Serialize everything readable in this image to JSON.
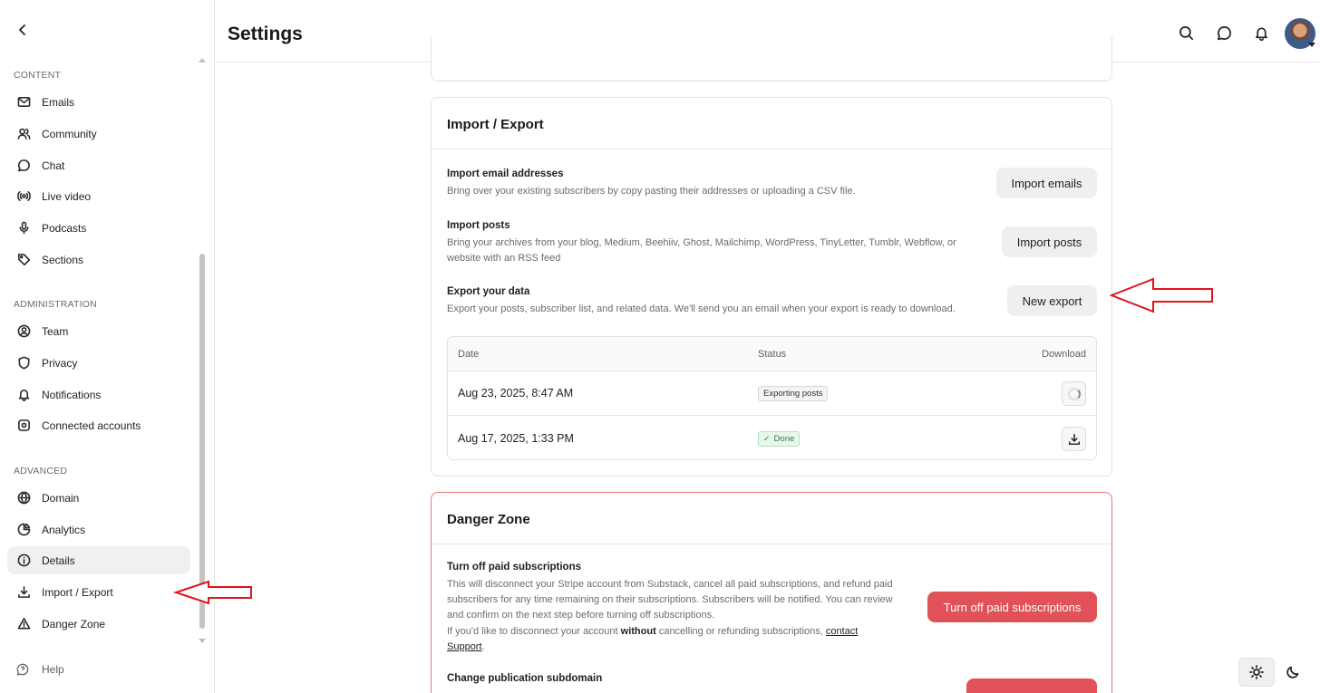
{
  "header": {
    "title": "Settings"
  },
  "sidebar": {
    "sections": [
      {
        "label": "CONTENT"
      },
      {
        "label": "ADMINISTRATION"
      },
      {
        "label": "ADVANCED"
      }
    ],
    "items": [
      {
        "label": "Emails",
        "icon": "mail-icon"
      },
      {
        "label": "Community",
        "icon": "users-icon"
      },
      {
        "label": "Chat",
        "icon": "chat-bubble-icon"
      },
      {
        "label": "Live video",
        "icon": "broadcast-icon"
      },
      {
        "label": "Podcasts",
        "icon": "microphone-icon"
      },
      {
        "label": "Sections",
        "icon": "tag-icon"
      },
      {
        "label": "Team",
        "icon": "user-circle-icon"
      },
      {
        "label": "Privacy",
        "icon": "shield-icon"
      },
      {
        "label": "Notifications",
        "icon": "bell-icon"
      },
      {
        "label": "Connected accounts",
        "icon": "gear-icon"
      },
      {
        "label": "Domain",
        "icon": "globe-icon"
      },
      {
        "label": "Analytics",
        "icon": "pie-chart-icon"
      },
      {
        "label": "Details",
        "icon": "info-icon"
      },
      {
        "label": "Import / Export",
        "icon": "download-icon"
      },
      {
        "label": "Danger Zone",
        "icon": "warning-icon"
      }
    ],
    "active": "Details",
    "help": "Help"
  },
  "import_export": {
    "title": "Import / Export",
    "rows": [
      {
        "title": "Import email addresses",
        "desc": "Bring over your existing subscribers by copy pasting their addresses or uploading a CSV file.",
        "button": "Import emails"
      },
      {
        "title": "Import posts",
        "desc_1": "Bring your archives from your blog, Medium, Beehiiv, Ghost, Mailchimp, WordPress, TinyLetter, Tumblr, Webflow, or",
        "desc_2": "website with an RSS feed",
        "button": "Import posts"
      },
      {
        "title": "Export your data",
        "desc": "Export your posts, subscriber list, and related data. We'll send you an email when your export is ready to download.",
        "button": "New export"
      }
    ],
    "table": {
      "columns": [
        "Date",
        "Status",
        "Download"
      ],
      "rows": [
        {
          "date": "Aug 23, 2025, 8:47 AM",
          "status": "Exporting posts"
        },
        {
          "date": "Aug 17, 2025, 1:33 PM",
          "status": "Done"
        }
      ]
    }
  },
  "danger_zone": {
    "title": "Danger Zone",
    "turn_off": {
      "title": "Turn off paid subscriptions",
      "desc_1": "This will disconnect your Stripe account from Substack, cancel all paid subscriptions, and refund paid",
      "desc_2": "subscribers for any time remaining on their subscriptions. Subscribers will be notified. You can review",
      "desc_3": "and confirm on the next step before turning off subscriptions.",
      "desc_4a": "If you'd like to disconnect your account ",
      "desc_4b": "without",
      "desc_4c": " cancelling or refunding subscriptions, ",
      "link_1": "contact",
      "link_2": "Support",
      "desc_end": ".",
      "button": "Turn off paid subscriptions"
    },
    "subdomain": {
      "title": "Change publication subdomain"
    }
  },
  "colors": {
    "accent_red": "#e15258",
    "annotation_red": "#e0141e",
    "done_green": "#2e7d4f"
  }
}
